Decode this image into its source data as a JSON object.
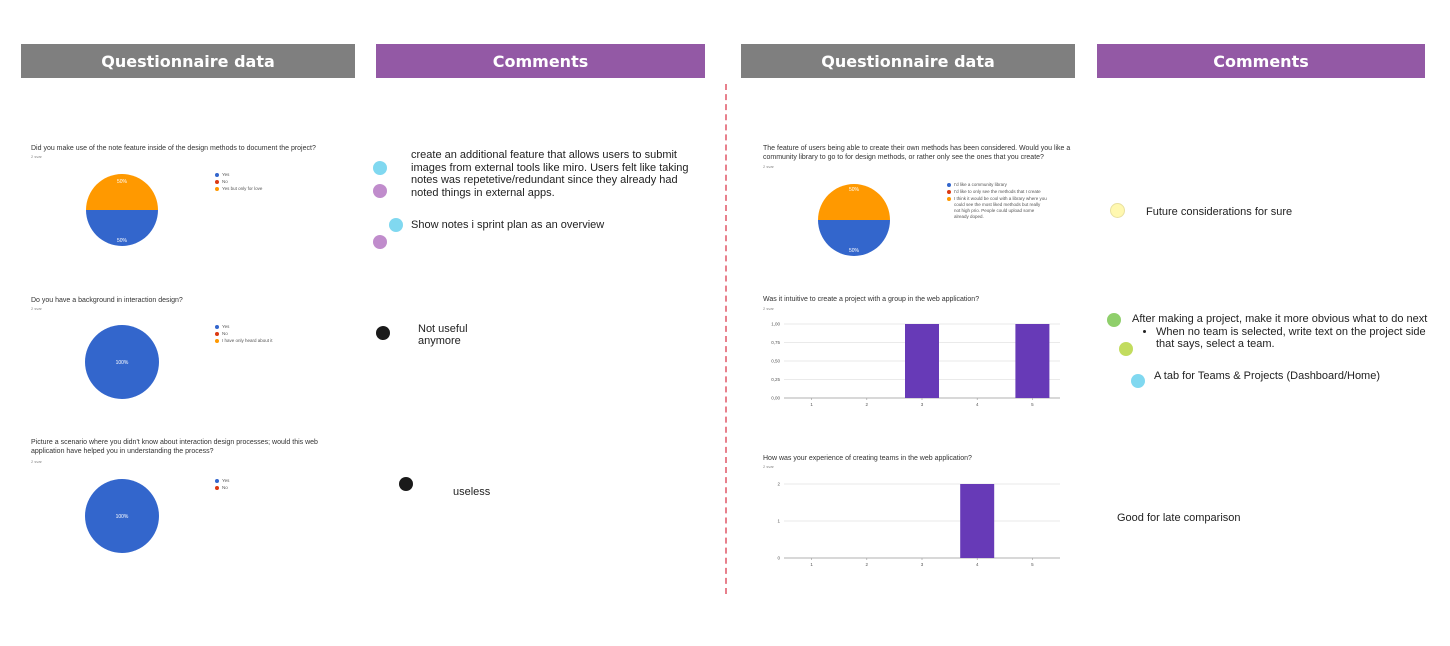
{
  "headers": {
    "left_questionnaire": "Questionnaire data",
    "left_comments": "Comments",
    "right_questionnaire": "Questionnaire data",
    "right_comments": "Comments"
  },
  "colors": {
    "gray_header": "#7f7f7f",
    "purple_header": "#9359a5",
    "pie_blue": "#3366cc",
    "pie_orange": "#ff9900",
    "pie_red": "#dc3912",
    "bar_purple": "#673ab7",
    "divider": "#e8808c"
  },
  "questions": [
    {
      "title": "Did you make use of the note feature inside of the design methods to document the project?",
      "responses": "2 svar",
      "legend": [
        "Yes",
        "No",
        "Yes but only for love"
      ],
      "slice_labels": [
        "50%",
        "50%"
      ]
    },
    {
      "title": "Do you have a background in interaction design?",
      "responses": "2 svar",
      "legend": [
        "Yes",
        "No",
        "I have only heard about it"
      ],
      "slice_labels": [
        "100%"
      ]
    },
    {
      "title_line1": "Picture a scenario where you didn't know about interaction design processes; would this web",
      "title_line2": "application have helped you in understanding the process?",
      "responses": "2 svar",
      "legend": [
        "Yes",
        "No"
      ],
      "slice_labels": [
        "100%"
      ]
    },
    {
      "title_line1": "The feature of users being able to create their own methods has been considered. Would you like a",
      "title_line2": "community library to go to for design methods, or rather only see the ones that you create?",
      "responses": "2 svar",
      "legend": [
        "I'd like a community library",
        "I'd like to only see the methods that I create",
        "I think it would be cool with a library where you could see the most liked methods but really not high prio. People could upload some already doped."
      ],
      "slice_labels": [
        "50%",
        "50%"
      ]
    },
    {
      "title": "Was it intuitive to create a project with a group in the web application?",
      "responses": "2 svar"
    },
    {
      "title": "How was your experience of creating teams in the web application?",
      "responses": "2 svar"
    }
  ],
  "chart_data": [
    {
      "type": "pie",
      "categories": [
        "Yes",
        "No",
        "Yes but only for love"
      ],
      "values": [
        50,
        0,
        50
      ]
    },
    {
      "type": "pie",
      "categories": [
        "Yes",
        "No",
        "I have only heard about it"
      ],
      "values": [
        100,
        0,
        0
      ]
    },
    {
      "type": "pie",
      "categories": [
        "Yes",
        "No"
      ],
      "values": [
        100,
        0
      ]
    },
    {
      "type": "pie",
      "categories": [
        "I'd like a community library",
        "I'd like to only see the methods that I create",
        "I think it would be cool with a library..."
      ],
      "values": [
        50,
        0,
        50
      ]
    },
    {
      "type": "bar",
      "categories": [
        "1",
        "2",
        "3",
        "4",
        "5"
      ],
      "values": [
        0,
        0,
        1,
        0,
        1
      ],
      "yticks": [
        "0,00",
        "0,25",
        "0,50",
        "0,75",
        "1,00"
      ],
      "ylim": [
        0,
        1
      ]
    },
    {
      "type": "bar",
      "categories": [
        "1",
        "2",
        "3",
        "4",
        "5"
      ],
      "values": [
        0,
        0,
        0,
        2,
        0
      ],
      "yticks": [
        "0",
        "1",
        "2"
      ],
      "ylim": [
        0,
        2
      ]
    }
  ],
  "comments": {
    "c1": "create an additional feature that allows users to submit images from external tools like miro. Users felt like taking notes was repetetive/redundant since they already had noted things in external apps.",
    "c2": "Show notes i sprint plan as an overview",
    "c3_line1": "Not useful",
    "c3_line2": "anymore",
    "c4": "useless",
    "c5": "Future considerations for sure",
    "c6": "After making a project, make it more obvious what to do next",
    "c6_bullet": "When no team is selected, write text on the project side that says, select a team.",
    "c7": "A tab for Teams & Projects (Dashboard/Home)",
    "c8": "Good for late comparison"
  }
}
